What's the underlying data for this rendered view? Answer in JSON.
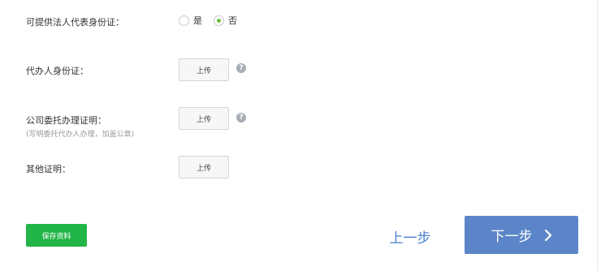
{
  "fields": {
    "legal_rep": {
      "label": "可提供法人代表身份证：",
      "options": [
        {
          "label": "是",
          "checked": false
        },
        {
          "label": "否",
          "checked": true
        }
      ]
    },
    "agent_id": {
      "label": "代办人身份证：",
      "upload_label": "上传"
    },
    "authorization": {
      "label": "公司委托办理证明：",
      "hint": "(写明委托代办人办理，加盖公章)",
      "upload_label": "上传"
    },
    "other": {
      "label": "其他证明：",
      "upload_label": "上传"
    }
  },
  "help_icon_glyph": "?",
  "footer": {
    "save_label": "保存资料",
    "prev_label": "上一步",
    "next_label": "下一步"
  },
  "colors": {
    "save_green": "#22b548",
    "next_blue": "#5b85c8",
    "prev_text_blue": "#4a7fd0",
    "radio_checked": "#6fbf44"
  }
}
